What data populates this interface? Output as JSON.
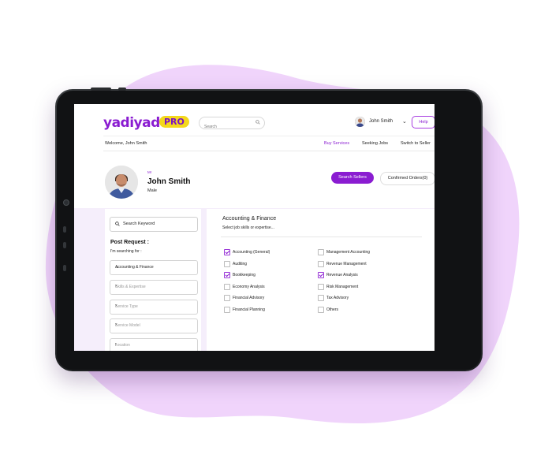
{
  "brand": {
    "logo_text": "yadiyad",
    "badge": "PRO",
    "accent_color": "#8a1cd1",
    "badge_color": "#f4d81c",
    "blob_color": "#f0d4fb"
  },
  "topbar": {
    "search_placeholder": "Search",
    "user_name": "John Smith",
    "help_label": "Help"
  },
  "subnav": {
    "welcome": "Welcome, John Smith",
    "links": [
      "Buy Services",
      "Seeking Jobs",
      "Switch to Seller"
    ],
    "active": "Buy Services"
  },
  "profile": {
    "salutation": "Mr",
    "name": "John Smith",
    "gender": "Male",
    "search_sellers": "Search Sellers",
    "confirmed_orders": "Confirmed Orders(0)"
  },
  "filters": {
    "keyword_placeholder": "Search Keyword",
    "post_request": "Post Request :",
    "searching_for": "I'm searching for :",
    "selects": [
      {
        "label": "Accounting & Finance",
        "icon": "chevron-down-icon"
      },
      {
        "label": "Skills & Expertise",
        "icon": "chevron-right-icon"
      },
      {
        "label": "Service Type",
        "icon": "chevron-right-icon"
      },
      {
        "label": "Service Model",
        "icon": "chevron-right-icon"
      },
      {
        "label": "Location",
        "icon": "chevron-right-icon"
      }
    ]
  },
  "category": {
    "title": "Accounting & Finance",
    "subtitle": "Select job skills or expertise...",
    "options": [
      {
        "label": "Accounting (General)",
        "checked": true
      },
      {
        "label": "Management Accounting",
        "checked": false
      },
      {
        "label": "Auditing",
        "checked": false
      },
      {
        "label": "Revenue Management",
        "checked": false
      },
      {
        "label": "Bookkeeping",
        "checked": true
      },
      {
        "label": "Revenue Analysis",
        "checked": true
      },
      {
        "label": "Economy Analysis",
        "checked": false
      },
      {
        "label": "Risk Management",
        "checked": false
      },
      {
        "label": "Financial Advisory",
        "checked": false
      },
      {
        "label": "Tax Advisory",
        "checked": false
      },
      {
        "label": "Financial Planning",
        "checked": false
      },
      {
        "label": "Others",
        "checked": false
      }
    ]
  }
}
